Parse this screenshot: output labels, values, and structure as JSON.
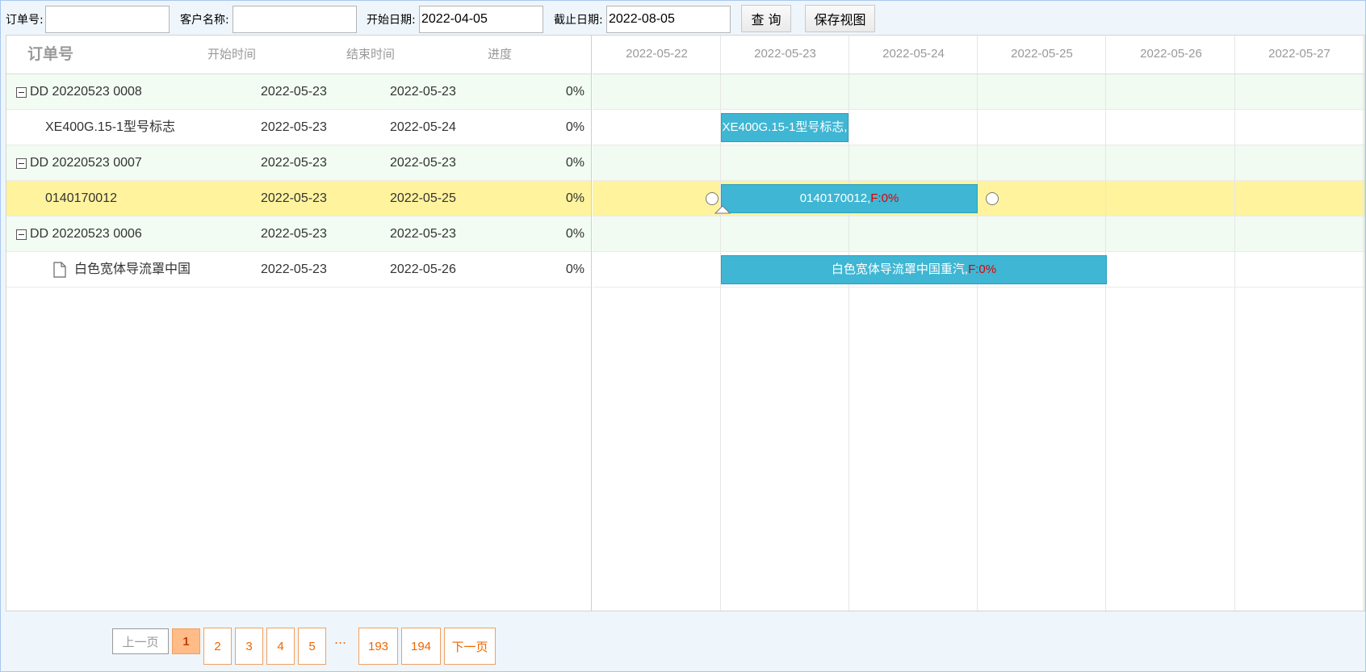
{
  "toolbar": {
    "order_label": "订单号:",
    "order_value": "",
    "customer_label": "客户名称:",
    "customer_value": "",
    "start_label": "开始日期:",
    "start_value": "2022-04-05",
    "end_label": "截止日期:",
    "end_value": "2022-08-05",
    "query_button": "查 询",
    "save_view_button": "保存视图"
  },
  "grid": {
    "headers": {
      "order": "订单号",
      "start": "开始时间",
      "end": "结束时间",
      "progress": "进度"
    },
    "rows": [
      {
        "name": "DD 20220523 0008",
        "start": "2022-05-23",
        "end": "2022-05-23",
        "progress": "0%",
        "type": "group"
      },
      {
        "name": "XE400G.15-1型号标志",
        "start": "2022-05-23",
        "end": "2022-05-24",
        "progress": "0%",
        "type": "child"
      },
      {
        "name": "DD 20220523 0007",
        "start": "2022-05-23",
        "end": "2022-05-23",
        "progress": "0%",
        "type": "group"
      },
      {
        "name": "0140170012",
        "start": "2022-05-23",
        "end": "2022-05-25",
        "progress": "0%",
        "type": "child",
        "selected": true
      },
      {
        "name": "DD 20220523 0006",
        "start": "2022-05-23",
        "end": "2022-05-23",
        "progress": "0%",
        "type": "group"
      },
      {
        "name": "白色宽体导流罩中国",
        "start": "2022-05-23",
        "end": "2022-05-26",
        "progress": "0%",
        "type": "file"
      }
    ]
  },
  "gantt": {
    "days": [
      "2022-05-22",
      "2022-05-23",
      "2022-05-24",
      "2022-05-25",
      "2022-05-26",
      "2022-05-27"
    ],
    "bars": [
      {
        "label": "XE400G.15-1型号标志,",
        "pct": ""
      },
      {
        "label": "0140170012,",
        "pct": "F:0%"
      },
      {
        "label": "白色宽体导流罩中国重汽,",
        "pct": "F:0%"
      }
    ],
    "colors": {
      "bar": "#3fb6d3",
      "selected_row": "#fff39e",
      "group_row": "#f2fcf2",
      "percent": "#e00000"
    }
  },
  "pager": {
    "prev": "上一页",
    "pages": [
      "1",
      "2",
      "3",
      "4",
      "5"
    ],
    "ellipsis": "…",
    "last_pages": [
      "193",
      "194"
    ],
    "next": "下一页",
    "current": "1"
  }
}
